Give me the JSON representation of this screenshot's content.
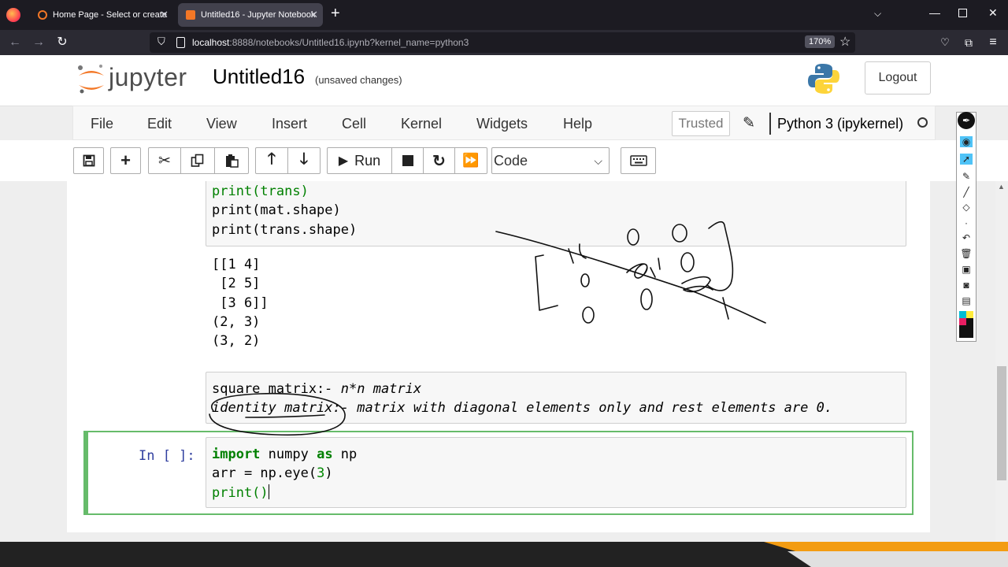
{
  "browser": {
    "tabs": [
      {
        "title": "Home Page - Select or create a",
        "active": false
      },
      {
        "title": "Untitled16 - Jupyter Notebook",
        "active": true
      }
    ],
    "new_tab": "+",
    "url_host": "localhost",
    "url_rest": ":8888/notebooks/Untitled16.ipynb?kernel_name=python3",
    "zoom": "170%"
  },
  "jupyter": {
    "logo_text": "jupyter",
    "notebook_name": "Untitled16",
    "save_status": "(unsaved changes)",
    "logout_label": "Logout"
  },
  "menubar": {
    "items": [
      "File",
      "Edit",
      "View",
      "Insert",
      "Cell",
      "Kernel",
      "Widgets",
      "Help"
    ],
    "trusted": "Trusted",
    "kernel": "Python 3 (ipykernel)"
  },
  "toolbar": {
    "run_label": "Run",
    "cell_type": "Code"
  },
  "cells": {
    "cell1": {
      "lines": [
        "print(trans)",
        "print(mat.shape)",
        "print(trans.shape)"
      ],
      "output": [
        "[[1 4]",
        " [2 5]",
        " [3 6]]",
        "(2, 3)",
        "(3, 2)"
      ]
    },
    "markdown": {
      "line1_a": "square matrix:",
      "line1_b": "- n*n matrix",
      "line2_a": "identity matrix",
      "line2_b": ":- matrix with diagonal elements only and rest elements are 0."
    },
    "active": {
      "prompt": "In [ ]:",
      "line1_kw1": "import",
      "line1_mid": " numpy ",
      "line1_kw2": "as",
      "line1_end": " np",
      "line2_a": "arr = np.eye(",
      "line2_num": "3",
      "line2_b": ")",
      "line3": "print()"
    }
  },
  "colors": {
    "active_cell_border": "#66bb6a",
    "prompt": "#303f9f",
    "keyword": "#008000",
    "jupyter_orange": "#f37726"
  }
}
